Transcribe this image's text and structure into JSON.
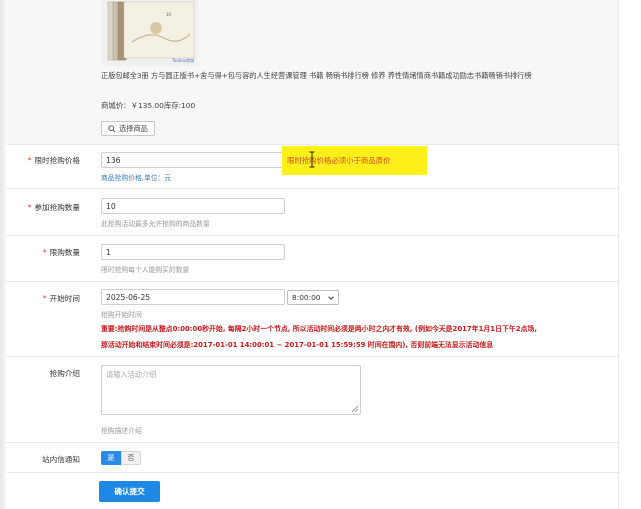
{
  "product": {
    "title": "正版包邮全3册 方与圆正版书+舍与得+包与容的人生经营课管理 书籍 畅销书排行榜 修养 养性情绪情商书籍成功励志书籍畅销书排行榜",
    "price_line": "商城价：￥135.00库存:100",
    "select_button": "选择商品",
    "book_tag": "10",
    "book_brand": "Taobao商城"
  },
  "form": {
    "flash_price": {
      "label": "限时抢购价格",
      "value": "136",
      "hint": "商品抢购价格,单位：元",
      "error": "限时抢购价格必须小于商品原价"
    },
    "join_qty": {
      "label": "参加抢购数量",
      "value": "10",
      "hint": "此抢购活动最多允许抢购的商品数量"
    },
    "limit_qty": {
      "label": "限购数量",
      "value": "1",
      "hint": "限时抢购每个人能购买的数量"
    },
    "start_time": {
      "label": "开始时间",
      "date": "2025-06-25",
      "time": "8:00:00",
      "hint": "抢购开始时间",
      "warning1": "重要:抢购时间是从整点0:00:00秒开始, 每隔2小时一个节点, 所以活动时间必须是两小时之内才有效, (例如今天是2017年1月1日下午2点场,",
      "warning2": "那活动开始和结束时间必须是:2017-01-01 14:00:01 ~ 2017-01-01 15:59:59 时间在围内), 否则前端无法显示活动信息"
    },
    "intro": {
      "label": "抢购介绍",
      "placeholder": "请输入活动介绍",
      "hint": "抢购描述介绍"
    },
    "notify": {
      "label": "站内信通知",
      "yes": "是",
      "no": "否",
      "selected": "是"
    },
    "submit": "确认提交"
  },
  "colors": {
    "primary": "#1e88e5",
    "required": "#e3342f",
    "highlight": "#ffef1a",
    "warning": "#c41a1a"
  }
}
